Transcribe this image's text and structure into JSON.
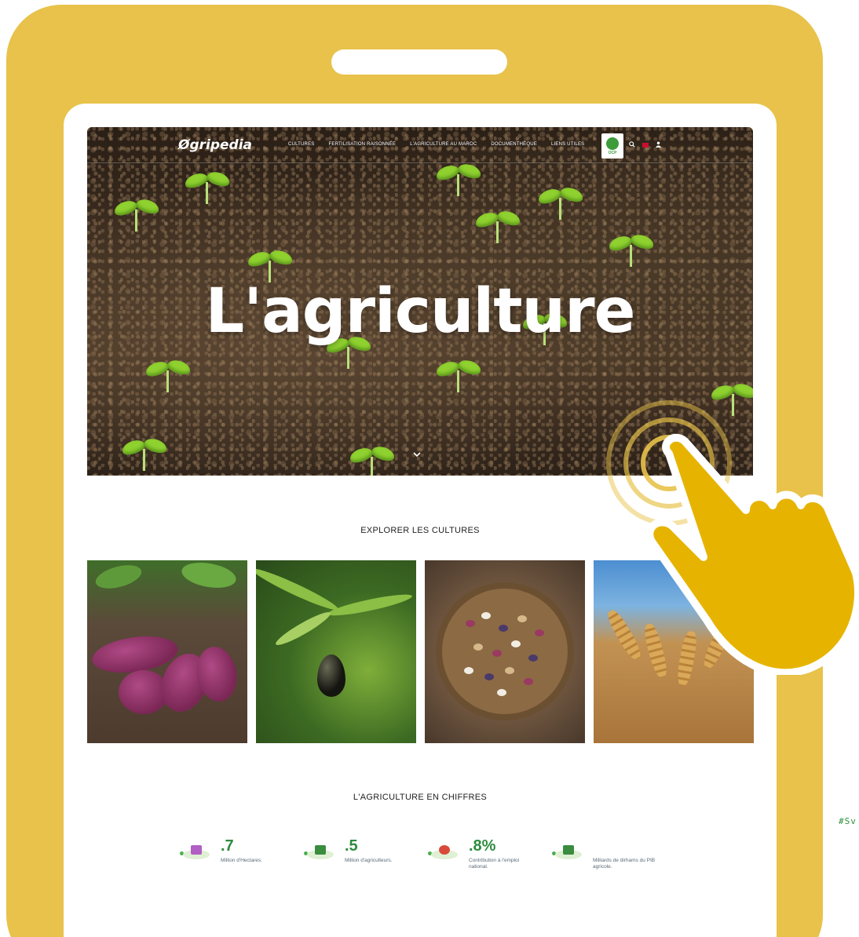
{
  "nav": {
    "logo": "Øgripedia",
    "links": [
      "CULTURES",
      "FERTILISATION RAISONNÉE",
      "L'AGRICULTURE AU MAROC",
      "DOCUMENTHÈQUE",
      "LIENS UTILES"
    ],
    "partner_logo_text": "OCP",
    "icons": [
      "search-icon",
      "flag-icon",
      "user-icon"
    ]
  },
  "hero": {
    "title": "L'agriculture",
    "scroll_icon": "chevron-down-icon"
  },
  "crops_section": {
    "title": "EXPLORER LES CULTURES",
    "items": [
      {
        "name": "sweet-potato"
      },
      {
        "name": "olive"
      },
      {
        "name": "beans"
      },
      {
        "name": "wheat"
      }
    ]
  },
  "figures_section": {
    "title": "L'AGRICULTURE EN CHIFFRES",
    "stats": [
      {
        "value": ".7",
        "label": "Million d'Hectares.",
        "icon": "field-icon",
        "accent": "#b15fc4"
      },
      {
        "value": ".5",
        "label": "Million d'agriculteurs.",
        "icon": "farmers-icon",
        "accent": "#3a8c3f"
      },
      {
        "value": ".8%",
        "label": "Contribution à l'emploi national.",
        "icon": "employment-icon",
        "accent": "#d9493b"
      },
      {
        "value": "",
        "label": "Milliards de dirhams du PIB agricole.",
        "icon": "growth-chart-icon",
        "accent": "#3a8c3f"
      }
    ]
  },
  "side_tag": "#Sv",
  "colors": {
    "tablet_frame": "#e8c24a",
    "hand": "#e6b400",
    "stat_value": "#2e8b3e"
  }
}
